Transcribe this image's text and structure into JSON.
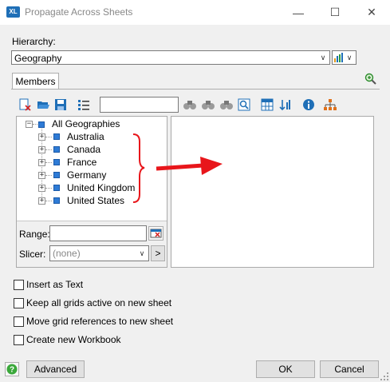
{
  "window": {
    "app_icon": "XL",
    "title": "Propagate Across Sheets",
    "minimize": "—",
    "maximize": "☐",
    "close": "✕"
  },
  "hierarchy": {
    "label": "Hierarchy:",
    "value": "Geography"
  },
  "tabs": [
    {
      "label": "Members"
    }
  ],
  "tree": {
    "root": "All Geographies",
    "children": [
      "Australia",
      "Canada",
      "France",
      "Germany",
      "United Kingdom",
      "United States"
    ]
  },
  "range": {
    "label": "Range:",
    "value": ""
  },
  "slicer": {
    "label": "Slicer:",
    "value": "(none)",
    "go": ">"
  },
  "options": [
    {
      "label": "Insert as Text",
      "checked": false
    },
    {
      "label": "Keep all grids active on new sheet",
      "checked": false
    },
    {
      "label": "Move grid references to new sheet",
      "checked": false
    },
    {
      "label": "Create new Workbook",
      "checked": false
    }
  ],
  "buttons": {
    "advanced": "Advanced",
    "ok": "OK",
    "cancel": "Cancel"
  },
  "colors": {
    "annotation": "#e8161b",
    "node": "#2e7bd6",
    "help": "#3aa83a"
  }
}
